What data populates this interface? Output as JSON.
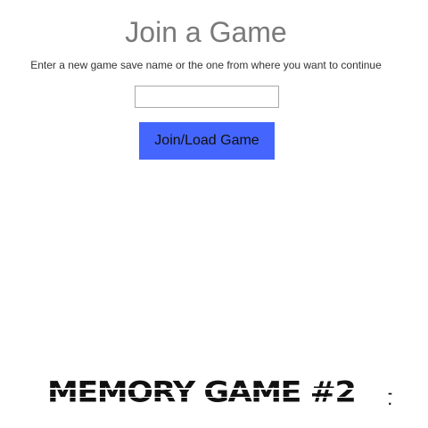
{
  "page": {
    "title": "Join a Game",
    "instructions": "Enter a new game save name or the one from where you want to continue"
  },
  "form": {
    "save_name_value": "",
    "save_name_placeholder": "",
    "submit_label": "Join/Load Game"
  },
  "logo": {
    "text": "MEMORY GAME #2",
    "style": "black glitch wordmark"
  },
  "colors": {
    "title": "#7a7a7a",
    "button_bg": "#4466ff",
    "logo": "#111111"
  }
}
